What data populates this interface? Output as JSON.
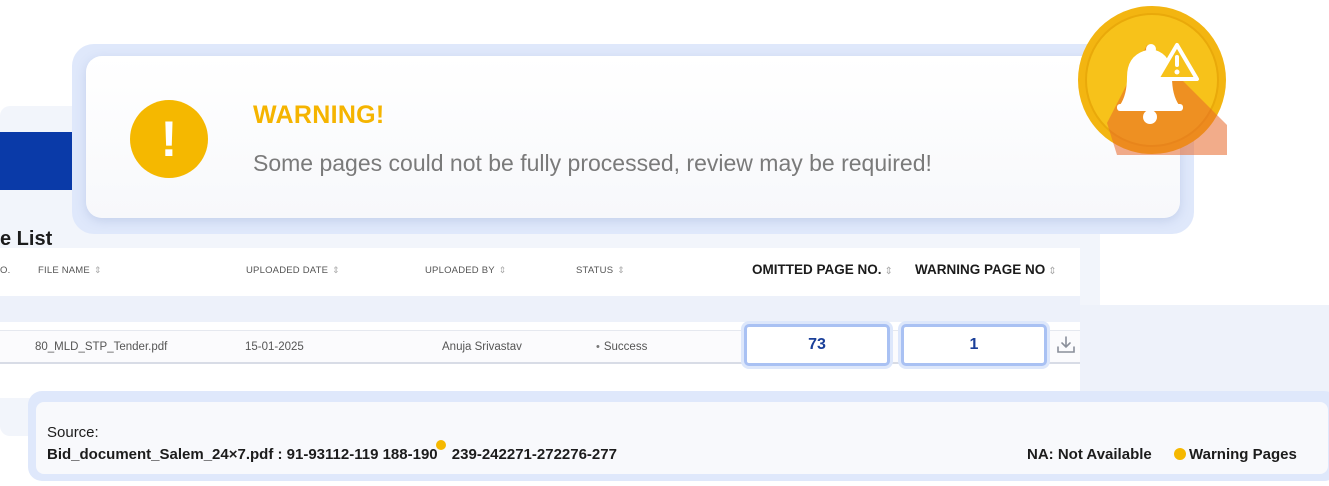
{
  "background": {
    "list_title": "e List",
    "columns": [
      {
        "label": "O.",
        "sort_icon": "sort-icon"
      },
      {
        "label": "FILE NAME",
        "sort_icon": "sort-icon"
      },
      {
        "label": "UPLOADED DATE",
        "sort_icon": "sort-icon"
      },
      {
        "label": "UPLOADED BY",
        "sort_icon": "sort-icon"
      },
      {
        "label": "STATUS",
        "sort_icon": "sort-icon"
      },
      {
        "label": "OMITTED PAGE NO.",
        "sort_icon": "sort-icon"
      },
      {
        "label": "WARNING PAGE NO",
        "sort_icon": "sort-icon"
      }
    ],
    "sort_glyph": "⇕",
    "row": {
      "file_name": "80_MLD_STP_Tender.pdf",
      "uploaded_date": "15-01-2025",
      "uploaded_by": "Anuja Srivastav",
      "status": "Success",
      "status_bullet": "•",
      "omitted_page_no": "73",
      "warning_page_no": "1"
    }
  },
  "warning": {
    "icon_glyph": "!",
    "title": "WARNING!",
    "message": "Some pages could not be fully processed, review may be required!"
  },
  "source": {
    "label": "Source:",
    "text_before": "Bid_document_Salem_24×7.pdf : 91-93112-119 188-190",
    "text_after": " 239-242271-272276-277",
    "legend_na": "NA: Not Available",
    "legend_warning": "Warning Pages"
  },
  "colors": {
    "warning_yellow": "#f5b800",
    "brand_blue": "#0a3aa8",
    "badge_orange": "#e8672a",
    "box_border": "#a9c1f3"
  },
  "icons": [
    "warning-icon",
    "bell-alert-icon",
    "download-icon",
    "sort-icon",
    "warning-dot-icon"
  ]
}
